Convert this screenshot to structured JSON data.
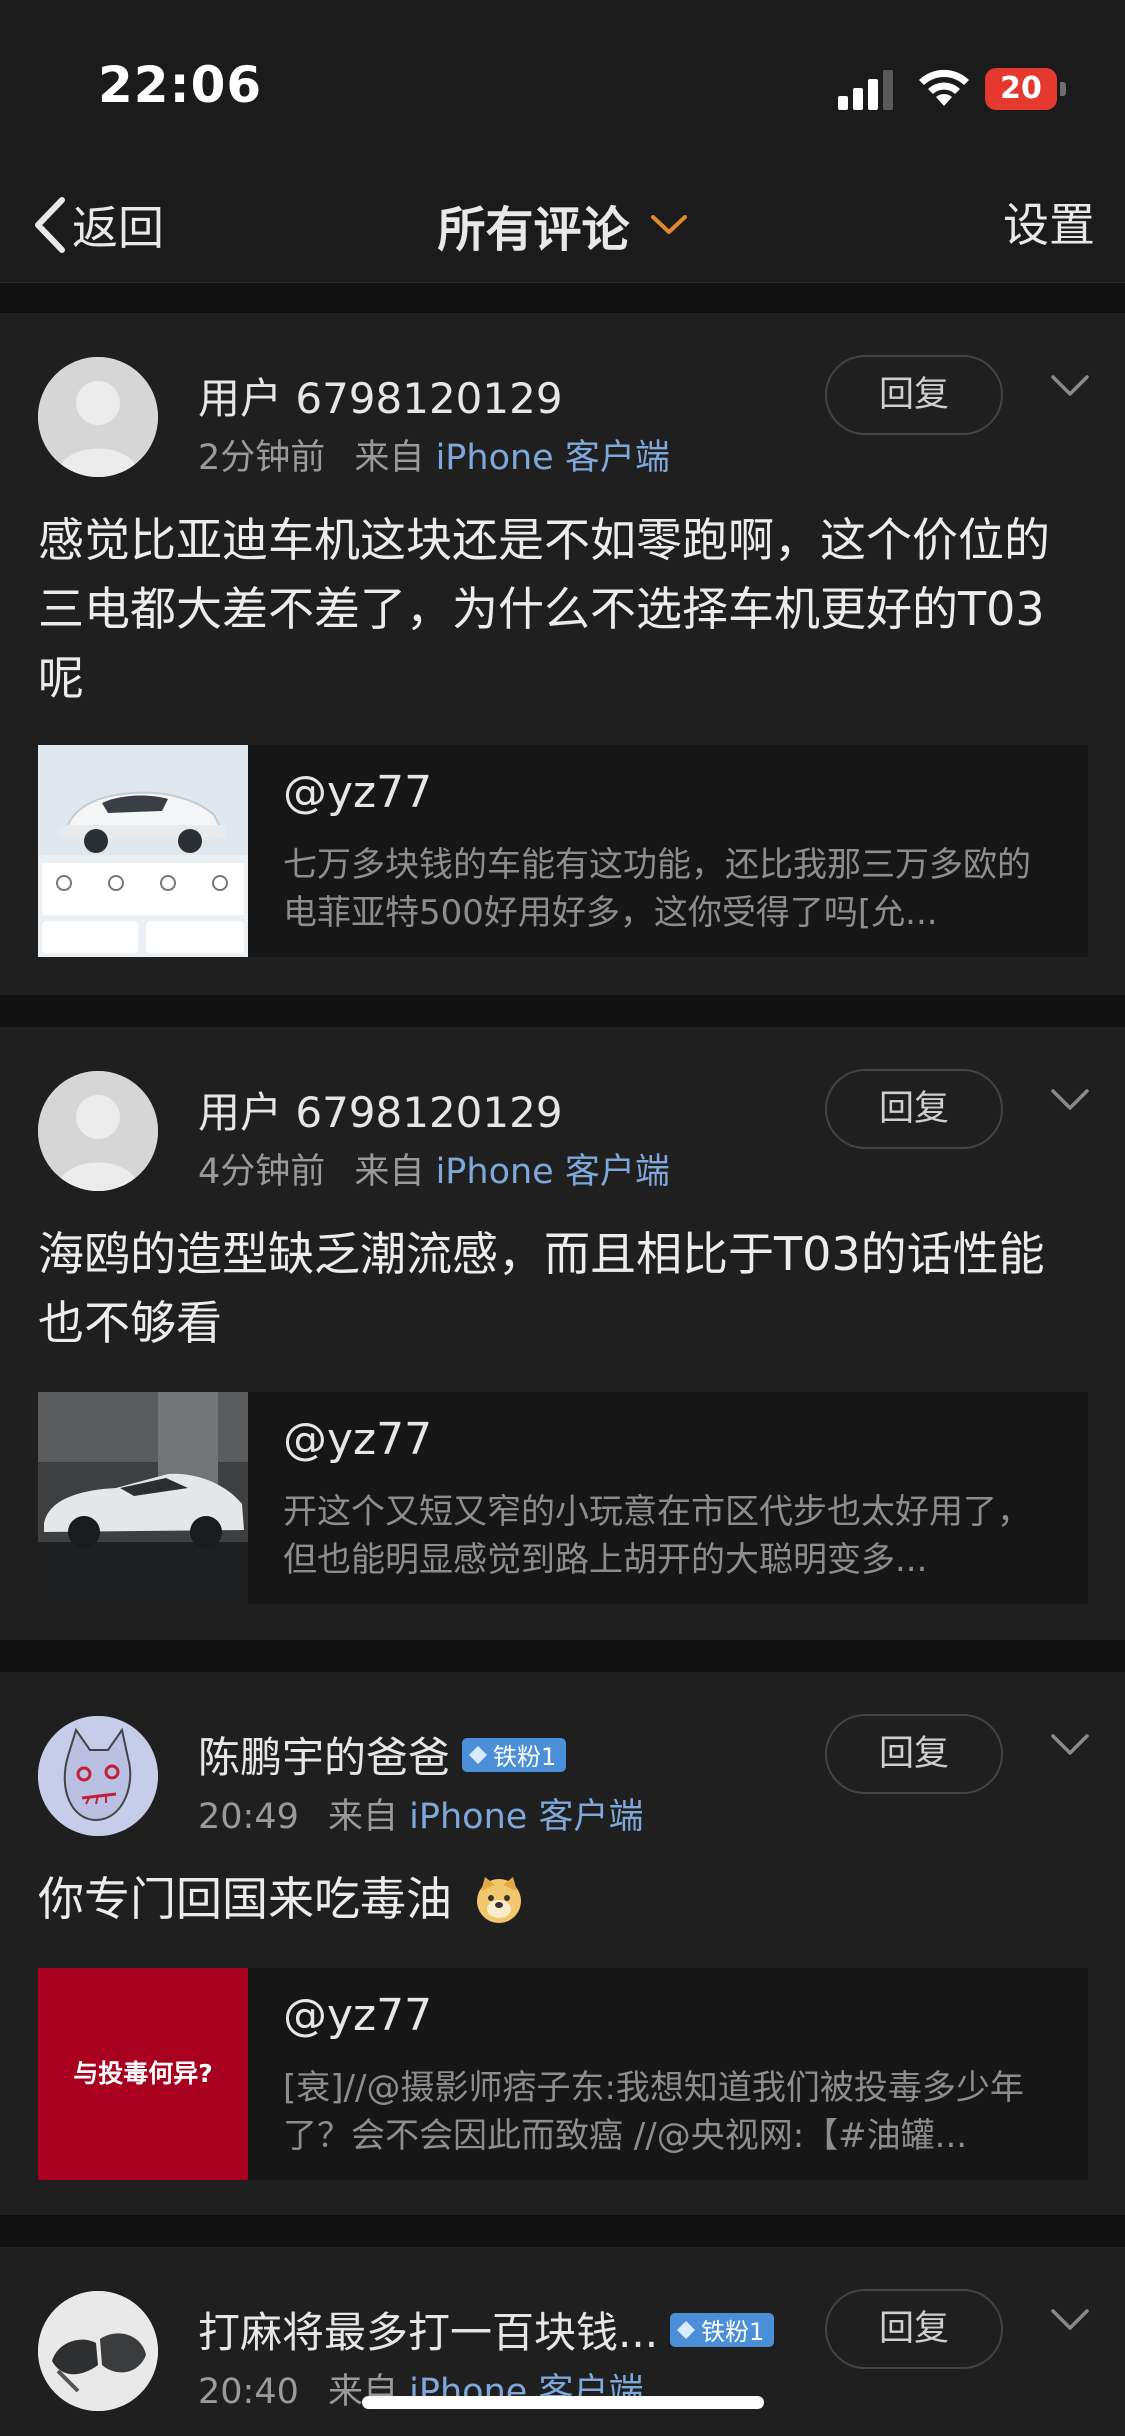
{
  "status_bar": {
    "time": "22:06",
    "battery": "20"
  },
  "nav": {
    "back_label": "返回",
    "title": "所有评论",
    "settings_label": "设置"
  },
  "comments": [
    {
      "username": "用户 6798120129",
      "time": "2分钟前",
      "from_prefix": "来自",
      "source": "iPhone 客户端",
      "reply_label": "回复",
      "text": "感觉比亚迪车机这块还是不如零跑啊，这个价位的三电都大差不差了，为什么不选择车机更好的T03呢",
      "quote": {
        "user": "@yz77",
        "text": "七万多块钱的车能有这功能，还比我那三万多欧的电菲亚特500好用好多，这你受得了吗[允..."
      }
    },
    {
      "username": "用户 6798120129",
      "time": "4分钟前",
      "from_prefix": "来自",
      "source": "iPhone 客户端",
      "reply_label": "回复",
      "text": "海鸥的造型缺乏潮流感，而且相比于T03的话性能也不够看",
      "quote": {
        "user": "@yz77",
        "text": "开这个又短又窄的小玩意在市区代步也太好用了，但也能明显感觉到路上胡开的大聪明变多..."
      }
    },
    {
      "username": "陈鹏宇的爸爸",
      "badge": "铁粉1",
      "time": "20:49",
      "from_prefix": "来自",
      "source": "iPhone 客户端",
      "reply_label": "回复",
      "text": "你专门回国来吃毒油",
      "quote": {
        "user": "@yz77",
        "thumb_text": "与投毒何异?",
        "text": "[衰]//@摄影师痞子东:我想知道我们被投毒多少年了？会不会因此而致癌 //@央视网:【#油罐..."
      }
    },
    {
      "username": "打麻将最多打一百块钱...",
      "badge": "铁粉1",
      "time": "20:40",
      "from_prefix": "来自",
      "source": "iPhone 客户端",
      "reply_label": "回复"
    }
  ],
  "colors": {
    "background": "#111111",
    "card": "#1f1f1f",
    "accent": "#e0892b",
    "link": "#7fa7d9",
    "badge": "#4b8fd8",
    "battery_low": "#e5392f"
  }
}
